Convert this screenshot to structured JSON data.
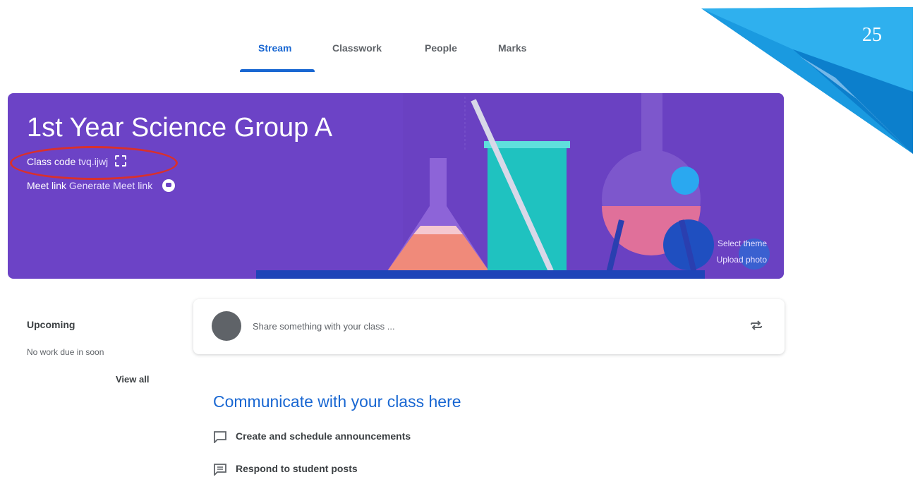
{
  "tabs": [
    {
      "label": "Stream",
      "active": true
    },
    {
      "label": "Classwork",
      "active": false
    },
    {
      "label": "People",
      "active": false
    },
    {
      "label": "Marks",
      "active": false
    }
  ],
  "slide_number": "25",
  "banner": {
    "title": "1st Year Science Group A",
    "class_code_label": "Class code",
    "class_code_value": "tvq.ijwj",
    "meet_label": "Meet link",
    "meet_value": "Generate Meet link",
    "select_theme": "Select theme",
    "upload_photo": "Upload photo",
    "color": "#6c43c6"
  },
  "upcoming": {
    "title": "Upcoming",
    "text": "No work due in soon",
    "view_all": "View all"
  },
  "share": {
    "placeholder": "Share something with your class ..."
  },
  "communicate": {
    "title": "Communicate with your class here",
    "items": [
      {
        "label": "Create and schedule announcements",
        "icon": "announcement-icon"
      },
      {
        "label": "Respond to student posts",
        "icon": "student-posts-icon"
      }
    ]
  },
  "colors": {
    "accent": "#1967d2",
    "highlight_ellipse": "#d9302c"
  }
}
